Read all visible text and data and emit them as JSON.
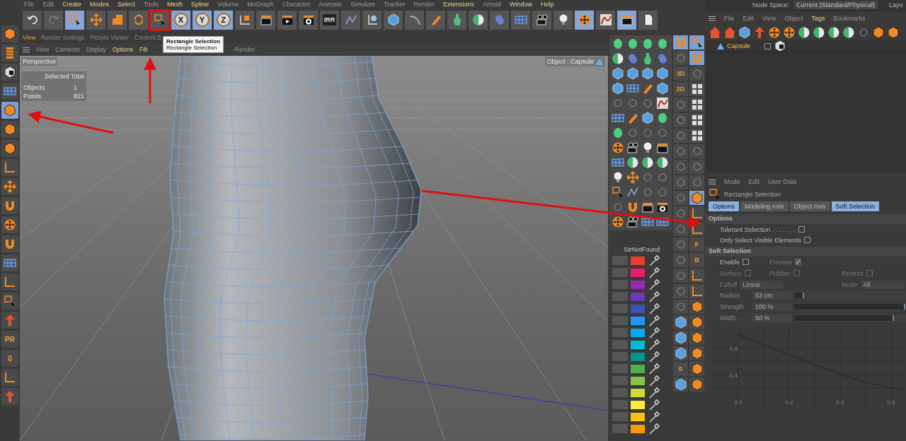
{
  "menu": [
    {
      "label": "File",
      "highlighted": false
    },
    {
      "label": "Edit",
      "highlighted": false
    },
    {
      "label": "Create",
      "highlighted": true
    },
    {
      "label": "Modes",
      "highlighted": true
    },
    {
      "label": "Select",
      "highlighted": true
    },
    {
      "label": "Tools",
      "highlighted": false
    },
    {
      "label": "Mesh",
      "highlighted": true
    },
    {
      "label": "Spline",
      "highlighted": true
    },
    {
      "label": "Volume",
      "highlighted": false
    },
    {
      "label": "MoGraph",
      "highlighted": false
    },
    {
      "label": "Character",
      "highlighted": false
    },
    {
      "label": "Animate",
      "highlighted": false
    },
    {
      "label": "Simulate",
      "highlighted": false
    },
    {
      "label": "Tracker",
      "highlighted": false
    },
    {
      "label": "Render",
      "highlighted": false
    },
    {
      "label": "Extensions",
      "highlighted": true
    },
    {
      "label": "Arnold",
      "highlighted": false
    },
    {
      "label": "Window",
      "highlighted": true
    },
    {
      "label": "Help",
      "highlighted": true
    }
  ],
  "toolbar": [
    {
      "kind": "icon",
      "selected": false,
      "annotated": false
    },
    {
      "kind": "icon",
      "selected": false,
      "annotated": false
    },
    {
      "kind": "icon",
      "selected": true,
      "annotated": false
    },
    {
      "kind": "icon",
      "selected": false,
      "annotated": false
    },
    {
      "kind": "icon",
      "selected": false,
      "annotated": false
    },
    {
      "kind": "icon",
      "selected": false,
      "annotated": false
    },
    {
      "kind": "icon",
      "selected": false,
      "annotated": true
    },
    {
      "kind": "axis",
      "label": "X",
      "selected": true,
      "annotated": false
    },
    {
      "kind": "axis",
      "label": "Y",
      "selected": true,
      "annotated": false
    },
    {
      "kind": "axis",
      "label": "Z",
      "selected": true,
      "annotated": false
    },
    {
      "kind": "icon",
      "selected": false,
      "annotated": false
    },
    {
      "kind": "icon",
      "selected": false,
      "annotated": false
    },
    {
      "kind": "icon",
      "selected": false,
      "annotated": false
    },
    {
      "kind": "icon",
      "selected": false,
      "annotated": false
    },
    {
      "kind": "text",
      "label": "IRR",
      "selected": false,
      "annotated": false
    },
    {
      "kind": "icon",
      "selected": false,
      "annotated": false
    },
    {
      "kind": "icon",
      "selected": false,
      "annotated": false
    },
    {
      "kind": "icon",
      "selected": false,
      "annotated": false
    },
    {
      "kind": "icon",
      "selected": false,
      "annotated": false
    },
    {
      "kind": "icon",
      "selected": false,
      "annotated": false
    },
    {
      "kind": "icon",
      "selected": false,
      "annotated": false
    },
    {
      "kind": "icon",
      "selected": false,
      "annotated": false
    },
    {
      "kind": "icon",
      "selected": false,
      "annotated": false
    },
    {
      "kind": "icon",
      "selected": false,
      "annotated": false
    },
    {
      "kind": "icon",
      "selected": false,
      "annotated": false
    },
    {
      "kind": "icon",
      "selected": false,
      "annotated": false
    },
    {
      "kind": "icon",
      "selected": true,
      "annotated": false
    },
    {
      "kind": "icon",
      "selected": false,
      "annotated": false
    },
    {
      "kind": "icon",
      "selected": true,
      "annotated": false
    },
    {
      "kind": "icon",
      "selected": false,
      "annotated": false
    }
  ],
  "left_tools": [
    {
      "kind": "icon",
      "selected": false
    },
    {
      "kind": "icon",
      "selected": false
    },
    {
      "kind": "icon",
      "selected": false
    },
    {
      "kind": "icon",
      "selected": false
    },
    {
      "kind": "icon",
      "selected": true
    },
    {
      "kind": "icon",
      "selected": false
    },
    {
      "kind": "icon",
      "selected": false
    },
    {
      "kind": "icon",
      "selected": false
    },
    {
      "kind": "icon",
      "selected": false
    },
    {
      "kind": "icon",
      "selected": false
    },
    {
      "kind": "icon",
      "selected": false
    },
    {
      "kind": "icon",
      "selected": false
    },
    {
      "kind": "icon",
      "selected": false
    },
    {
      "kind": "icon",
      "selected": false
    },
    {
      "kind": "icon",
      "selected": false
    },
    {
      "kind": "icon",
      "selected": false
    },
    {
      "kind": "text",
      "label": "PR",
      "selected": false
    },
    {
      "kind": "text",
      "label": "0",
      "selected": false
    },
    {
      "kind": "icon",
      "selected": false
    },
    {
      "kind": "icon",
      "selected": false
    }
  ],
  "viewport_tabs": [
    {
      "label": "View",
      "selected": true
    },
    {
      "label": "Render Settings",
      "selected": false
    },
    {
      "label": "Picture Viewer",
      "selected": false
    },
    {
      "label": "Content B",
      "selected": false
    }
  ],
  "view_menu": [
    {
      "label": "View",
      "highlighted": false
    },
    {
      "label": "Cameras",
      "highlighted": false
    },
    {
      "label": "Display",
      "highlighted": false
    },
    {
      "label": "Options",
      "highlighted": true
    },
    {
      "label": "Filt",
      "highlighted": true
    },
    {
      "label": "-Render",
      "highlighted": false
    }
  ],
  "viewport": {
    "camera": "Perspective",
    "hud": {
      "header": "Selected Total",
      "rows": [
        {
          "label": "Objects",
          "value": "1"
        },
        {
          "label": "Points",
          "value": "821"
        }
      ]
    },
    "object_label": "Object : Capsule"
  },
  "tooltip": {
    "title": "Rectangle Selection",
    "text": "Rectangle Selection"
  },
  "side_tools": [
    {
      "kind": "icon",
      "selected": true
    },
    {
      "kind": "icon",
      "selected": true
    },
    {
      "kind": "icon",
      "selected": false
    },
    {
      "kind": "icon",
      "selected": true
    },
    {
      "kind": "text",
      "label": "3D",
      "selected": false
    },
    {
      "kind": "icon",
      "selected": false
    },
    {
      "kind": "text",
      "label": "2D",
      "selected": false
    },
    {
      "kind": "icon",
      "selected": false
    },
    {
      "kind": "icon",
      "selected": false
    },
    {
      "kind": "icon",
      "selected": false
    },
    {
      "kind": "icon",
      "selected": false
    },
    {
      "kind": "icon",
      "selected": false
    },
    {
      "kind": "icon",
      "selected": false
    },
    {
      "kind": "icon",
      "selected": false
    },
    {
      "kind": "icon",
      "selected": false
    },
    {
      "kind": "icon",
      "selected": false
    },
    {
      "kind": "icon",
      "selected": false
    },
    {
      "kind": "icon",
      "selected": false
    },
    {
      "kind": "icon",
      "selected": false
    },
    {
      "kind": "icon",
      "selected": false
    },
    {
      "kind": "icon",
      "selected": false
    },
    {
      "kind": "icon",
      "selected": true
    },
    {
      "kind": "icon",
      "selected": false
    },
    {
      "kind": "icon",
      "selected": false
    },
    {
      "kind": "icon",
      "selected": false
    },
    {
      "kind": "icon",
      "selected": false
    },
    {
      "kind": "icon",
      "selected": false
    },
    {
      "kind": "text",
      "label": "F",
      "selected": false
    },
    {
      "kind": "icon",
      "selected": false
    },
    {
      "kind": "text",
      "label": "B",
      "selected": false
    },
    {
      "kind": "icon",
      "selected": false
    },
    {
      "kind": "icon",
      "selected": false
    },
    {
      "kind": "icon",
      "selected": false
    },
    {
      "kind": "icon",
      "selected": false
    },
    {
      "kind": "icon",
      "selected": false
    },
    {
      "kind": "icon",
      "selected": false
    },
    {
      "kind": "icon",
      "selected": false
    },
    {
      "kind": "icon",
      "selected": false
    },
    {
      "kind": "icon",
      "selected": false
    },
    {
      "kind": "icon",
      "selected": false
    },
    {
      "kind": "icon",
      "selected": false
    },
    {
      "kind": "icon",
      "selected": false
    },
    {
      "kind": "text",
      "label": "0",
      "selected": false
    },
    {
      "kind": "icon",
      "selected": false
    },
    {
      "kind": "icon",
      "selected": false
    },
    {
      "kind": "icon",
      "selected": false
    }
  ],
  "color_palette": {
    "title": "StrNotFound",
    "swatches": [
      {
        "color": "#f03c2e"
      },
      {
        "color": "#e91e63"
      },
      {
        "color": "#9c27b0"
      },
      {
        "color": "#673ab7"
      },
      {
        "color": "#3f51b5"
      },
      {
        "color": "#2196f3"
      },
      {
        "color": "#03a9f4"
      },
      {
        "color": "#00bcd4"
      },
      {
        "color": "#009688"
      },
      {
        "color": "#4caf50"
      },
      {
        "color": "#8bc34a"
      },
      {
        "color": "#cddc39"
      },
      {
        "color": "#ffeb3b"
      },
      {
        "color": "#ffc107"
      },
      {
        "color": "#ff9800"
      }
    ]
  },
  "node_space": {
    "label": "Node Space:",
    "value": "Current (Standard/Physical)",
    "layout": "Layo"
  },
  "object_manager": {
    "menu": [
      {
        "label": "File",
        "highlighted": false
      },
      {
        "label": "Edit",
        "highlighted": false
      },
      {
        "label": "View",
        "highlighted": false
      },
      {
        "label": "Object",
        "highlighted": false
      },
      {
        "label": "Tags",
        "highlighted": true
      },
      {
        "label": "Bookmarks",
        "highlighted": false
      }
    ],
    "objects": [
      {
        "name": "Capsule"
      }
    ]
  },
  "attributes": {
    "menu": [
      "Mode",
      "Edit",
      "User Data"
    ],
    "title": "Rectangle Selection",
    "tabs": [
      {
        "label": "Options",
        "selected": true
      },
      {
        "label": "Modeling Axis",
        "selected": false
      },
      {
        "label": "Object Axis",
        "selected": false
      },
      {
        "label": "Soft Selection",
        "selected": true
      }
    ],
    "options_header": "Options",
    "options": [
      {
        "label": "Tolerant Selection . . . . . . .",
        "checked": false
      },
      {
        "label": "Only Select Visible Elements",
        "checked": false
      }
    ],
    "soft_header": "Soft Selection",
    "soft_checks": [
      {
        "label": "Enable",
        "checked": false,
        "disabled": false
      },
      {
        "label": "Preview",
        "checked": true,
        "disabled": true
      },
      {
        "label": "Surface",
        "checked": false,
        "disabled": true
      },
      {
        "label": "Rubber",
        "checked": false,
        "disabled": true
      },
      {
        "label": "Restrict",
        "checked": false,
        "disabled": true
      }
    ],
    "falloff": {
      "label": "Falloff",
      "value": "Linear"
    },
    "mode": {
      "label": "Mode",
      "value": "All"
    },
    "sliders": [
      {
        "label": "Radius",
        "value": "53 cm",
        "level": 0.09
      },
      {
        "label": "Strength",
        "value": "100 %",
        "level": 1.0
      },
      {
        "label": "Width . . .",
        "value": "50 %",
        "level": 0.9
      }
    ],
    "chart_data": {
      "type": "line",
      "x": [
        0,
        0.1,
        0.2,
        0.3,
        0.4,
        0.5,
        0.6,
        0.65
      ],
      "series": [
        {
          "color": "#2a2a2a",
          "values": [
            1.0,
            0.85,
            0.7,
            0.55,
            0.41,
            0.29,
            0.21,
            0.18
          ]
        }
      ],
      "xlim": [
        -0.1,
        0.65
      ],
      "ylim": [
        -0.1,
        1.1
      ],
      "grid": true,
      "ref_lines": [
        {
          "axis": "y",
          "value": 0
        },
        {
          "axis": "y",
          "value": 1
        }
      ],
      "xticks": [
        {
          "value": 0,
          "label": "0.0"
        },
        {
          "value": 0.2,
          "label": "0.2"
        },
        {
          "value": 0.4,
          "label": "0.4"
        },
        {
          "value": 0.6,
          "label": "0.6"
        }
      ],
      "yticks": [
        {
          "value": 0.4,
          "label": "0.4"
        },
        {
          "value": 0.8,
          "label": "0.8"
        }
      ]
    }
  }
}
